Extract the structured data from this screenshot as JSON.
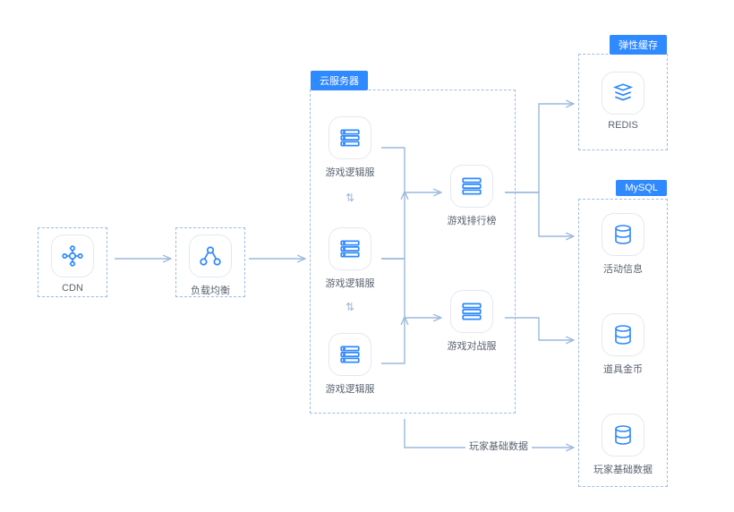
{
  "nodes": {
    "cdn": "CDN",
    "lb": "负载均衡",
    "logic1": "游戏逻辑服",
    "logic2": "游戏逻辑服",
    "logic3": "游戏逻辑服",
    "rank": "游戏排行榜",
    "pvp": "游戏对战服",
    "redis": "REDIS",
    "activity": "活动信息",
    "coins": "道具金币",
    "player": "玩家基础数据"
  },
  "panels": {
    "cloud_server": "云服务器",
    "cache": "弹性缓存",
    "mysql": "MySQL"
  },
  "flow_label": "玩家基础数据"
}
